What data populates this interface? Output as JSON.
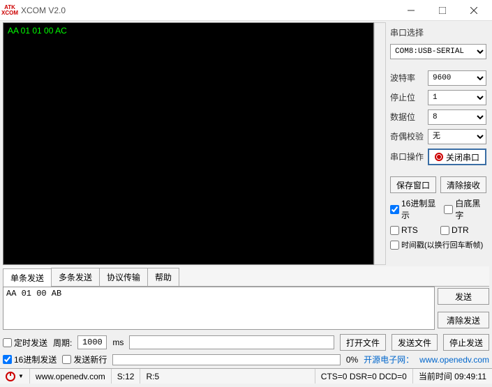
{
  "window": {
    "title": "XCOM V2.0",
    "logo_top": "ATK",
    "logo_bot": "XCOM"
  },
  "terminal": {
    "content": "AA 01 01 00 AC"
  },
  "side": {
    "port_label": "串口选择",
    "port_value": "COM8:USB-SERIAL",
    "baud_label": "波特率",
    "baud_value": "9600",
    "stop_label": "停止位",
    "stop_value": "1",
    "data_label": "数据位",
    "data_value": "8",
    "parity_label": "奇偶校验",
    "parity_value": "无",
    "op_label": "串口操作",
    "op_btn": "关闭串口",
    "save_window": "保存窗口",
    "clear_recv": "清除接收",
    "hex_disp": "16进制显示",
    "white_bg": "白底黑字",
    "rts": "RTS",
    "dtr": "DTR",
    "timestamp": "时间戳(以换行回车断帧)"
  },
  "tabs": {
    "t1": "单条发送",
    "t2": "多条发送",
    "t3": "协议传输",
    "t4": "帮助"
  },
  "send": {
    "content": "AA 01 00 AB",
    "send_btn": "发送",
    "clear_btn": "清除发送"
  },
  "ctrl": {
    "timed_send": "定时发送",
    "period_label": "周期:",
    "period_value": "1000",
    "period_unit": "ms",
    "open_file": "打开文件",
    "send_file": "发送文件",
    "stop_send": "停止发送",
    "hex_send": "16进制发送",
    "send_newline": "发送新行",
    "progress_pct": "0%",
    "promo_label": "开源电子网：",
    "promo_url": "www.openedv.com"
  },
  "status": {
    "url": "www.openedv.com",
    "s": "S:12",
    "r": "R:5",
    "signals": "CTS=0 DSR=0 DCD=0",
    "time_label": "当前时间 09:49:11"
  }
}
